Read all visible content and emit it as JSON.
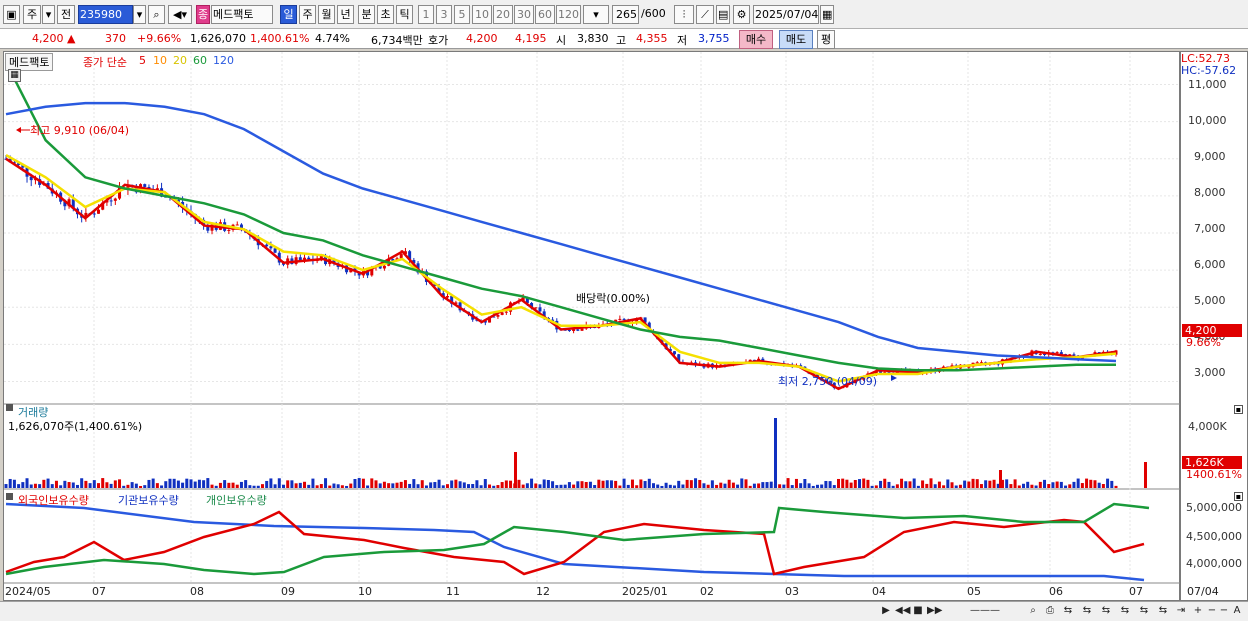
{
  "toolbar": {
    "period_label": "주",
    "mode_label": "전",
    "code_value": "235980",
    "stock_badge": "종",
    "stock_name": "메드팩토",
    "units": [
      "일",
      "주",
      "월",
      "년",
      "분",
      "초",
      "틱"
    ],
    "numbers": [
      "1",
      "3",
      "5",
      "10",
      "20",
      "30",
      "60",
      "120"
    ],
    "count_value": "265",
    "count_total": "/600",
    "date_value": "2025/07/04"
  },
  "info": {
    "price": "4,200",
    "change": "370",
    "change_pct": "+9.66%",
    "volume": "1,626,070",
    "volume_pct": "1,400.61%",
    "turnover": "4.74%",
    "amount": "6,734백만",
    "quote_label": "호가",
    "ask": "4,200",
    "bid": "4,195",
    "open_label": "시",
    "open": "3,830",
    "high_label": "고",
    "high": "4,355",
    "low_label": "저",
    "low": "3,755",
    "buy_label": "매수",
    "sell_label": "매도",
    "eval_label": "평"
  },
  "price_pane": {
    "name": "메드팩토",
    "legend_title": "종가 단순",
    "ma": [
      "5",
      "10",
      "20",
      "60",
      "120"
    ],
    "lc": "LC:52.73",
    "hc": "HC:-57.62",
    "high_note": "최고 9,910 (06/04)",
    "low_note": "최저 2,750 (04/09)",
    "div_note": "배당락(0.00%)",
    "y_ticks": [
      "11,000",
      "10,000",
      "9,000",
      "8,000",
      "7,000",
      "6,000",
      "5,000",
      "4,000",
      "3,000"
    ],
    "price_tag": "4,200",
    "pct_tag": "9.66%"
  },
  "volume_pane": {
    "title": "거래량",
    "value_text": "1,626,070주(1,400.61%)",
    "y_ticks": [
      "4,000K"
    ],
    "vol_tag": "1,626K",
    "pct_tag": "1400.61%"
  },
  "holdings_pane": {
    "legends": [
      "외국인보유수량",
      "기관보유수량",
      "개인보유수량"
    ],
    "y_ticks": [
      "5,000,000",
      "4,500,000",
      "4,000,000"
    ]
  },
  "x_axis": [
    "2024/05",
    "07",
    "08",
    "09",
    "10",
    "11",
    "12",
    "2025/01",
    "02",
    "03",
    "04",
    "05",
    "06",
    "07"
  ],
  "x_last": "07/04",
  "colors": {
    "ma5": "#e00000",
    "ma10": "#ff8c00",
    "ma20": "#f5e000",
    "ma60": "#1a9a3a",
    "ma120": "#2a5ae0",
    "up": "#e00000",
    "down": "#1030c0"
  },
  "chart_data": {
    "type": "line",
    "series": [
      {
        "name": "5",
        "values": [
          9000,
          8300,
          7400,
          8300,
          8100,
          7200,
          7100,
          6200,
          6300,
          5900,
          6500,
          5300,
          4600,
          5200,
          4400,
          4500,
          4700,
          3500,
          3400,
          3550,
          3400,
          2800,
          3300,
          3250,
          3400,
          3500,
          3800,
          3650,
          3800
        ]
      },
      {
        "name": "20",
        "values": [
          9100,
          8500,
          7700,
          8200,
          8100,
          7300,
          7100,
          6500,
          6400,
          6000,
          6300,
          5500,
          4800,
          5000,
          4500,
          4500,
          4600,
          3800,
          3500,
          3500,
          3400,
          3000,
          3200,
          3200,
          3400,
          3500,
          3600,
          3650,
          3750
        ]
      },
      {
        "name": "60",
        "values": [
          11600,
          9500,
          8500,
          8200,
          8000,
          7800,
          7500,
          7000,
          6800,
          6400,
          6100,
          5800,
          5500,
          5300,
          5000,
          4700,
          4400,
          4200,
          4100,
          3900,
          3700,
          3500,
          3350,
          3300,
          3300,
          3350,
          3400,
          3450,
          3450
        ]
      },
      {
        "name": "120",
        "values": [
          10200,
          10400,
          10500,
          10500,
          10400,
          10200,
          9800,
          9200,
          8600,
          8200,
          7900,
          7600,
          7300,
          7000,
          6700,
          6400,
          6100,
          5800,
          5500,
          5200,
          4900,
          4600,
          4200,
          3900,
          3800,
          3700,
          3650,
          3600,
          3550
        ]
      }
    ],
    "ylim": [
      2500,
      11500
    ]
  }
}
